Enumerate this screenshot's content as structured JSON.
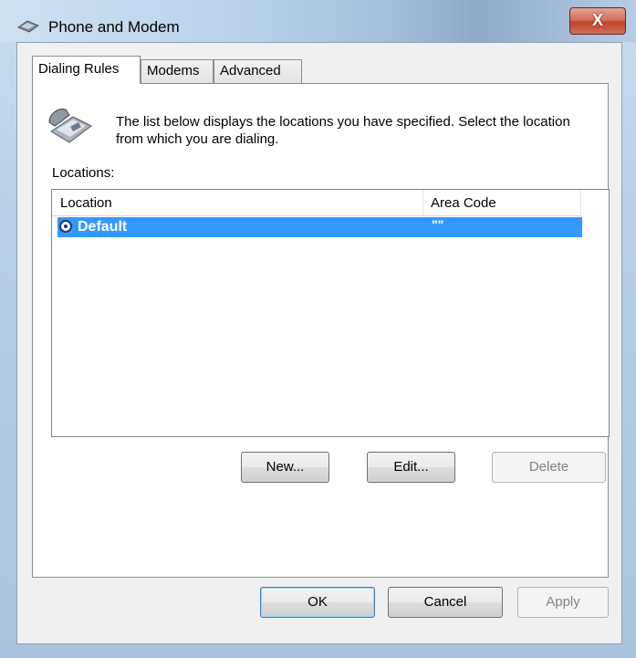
{
  "window": {
    "title": "Phone and Modem",
    "close_label": "X"
  },
  "tabs": [
    {
      "label": "Dialing Rules"
    },
    {
      "label": "Modems"
    },
    {
      "label": "Advanced"
    }
  ],
  "dialing": {
    "intro": "The list below displays the locations you have specified. Select the location from which you are dialing.",
    "locations_label": "Locations:",
    "columns": {
      "location": "Location",
      "area_code": "Area Code"
    },
    "rows": [
      {
        "location": "Default",
        "area_code": "\"\""
      }
    ],
    "buttons": {
      "new": "New...",
      "edit": "Edit...",
      "delete": "Delete"
    }
  },
  "footer": {
    "ok": "OK",
    "cancel": "Cancel",
    "apply": "Apply"
  },
  "colors": {
    "selection": "#3399ff",
    "close": "#c0432b"
  },
  "icons": {
    "title": "phone-modem-icon",
    "header": "telephone-icon",
    "row": "location-radio-icon"
  }
}
